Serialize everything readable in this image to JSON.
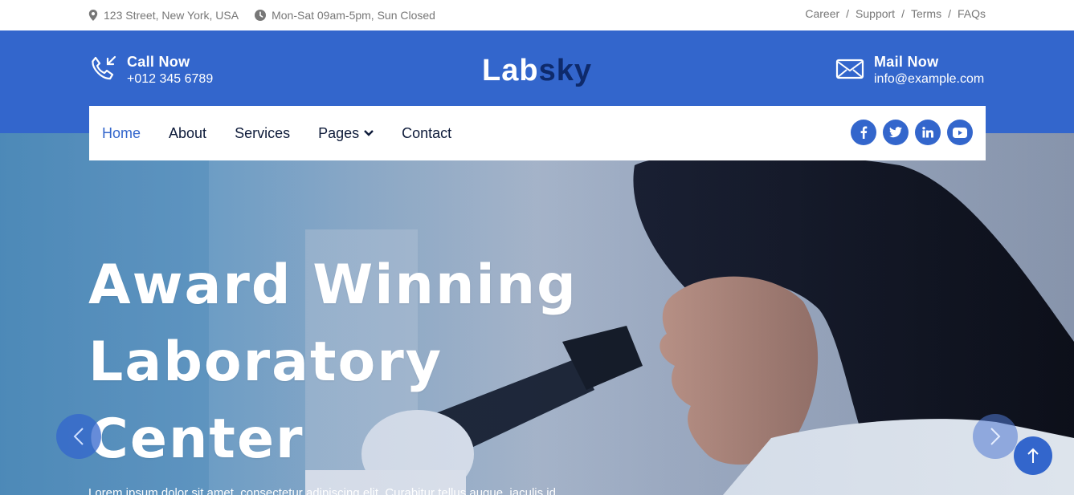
{
  "topbar": {
    "address": "123 Street, New York, USA",
    "hours": "Mon-Sat 09am-5pm, Sun Closed",
    "links": [
      "Career",
      "Support",
      "Terms",
      "FAQs"
    ],
    "separator": "/"
  },
  "header": {
    "call_label": "Call Now",
    "call_value": "+012 345 6789",
    "logo_part1": "Lab",
    "logo_part2": "sky",
    "mail_label": "Mail Now",
    "mail_value": "info@example.com"
  },
  "nav": {
    "items": [
      "Home",
      "About",
      "Services",
      "Pages",
      "Contact"
    ],
    "active": "Home",
    "social": [
      "facebook-icon",
      "twitter-icon",
      "linkedin-icon",
      "youtube-icon"
    ]
  },
  "hero": {
    "line1": "Award Winning",
    "line2": "Laboratory",
    "line3": "Center",
    "subtext": "Lorem ipsum dolor sit amet, consectetur adipiscing elit. Curabitur tellus augue, iaculis id"
  },
  "colors": {
    "primary": "#3366cc",
    "dark": "#0e2a6b",
    "text": "#0e1b3a",
    "muted": "#777777"
  }
}
